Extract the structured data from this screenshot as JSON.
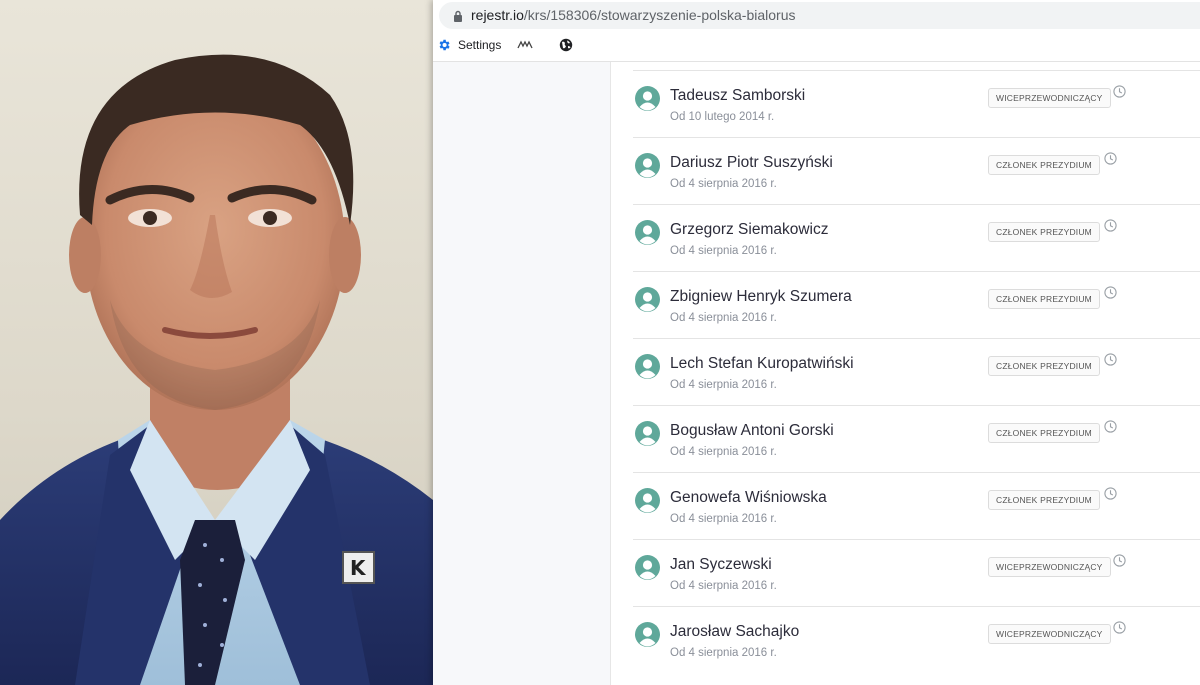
{
  "browser": {
    "url": {
      "host": "rejestr.io",
      "path": "/krs/158306/stowarzyszenie-polska-bialorus"
    },
    "bookmarks": [
      {
        "label": "Settings",
        "icon": "gear-icon"
      },
      {
        "label": "",
        "icon": "extension-icon"
      },
      {
        "label": "",
        "icon": "globe-icon"
      }
    ]
  },
  "people": [
    {
      "name": "Tadeusz Samborski",
      "date": "Od 10 lutego 2014 r.",
      "role": "WICEPRZEWODNICZĄCY"
    },
    {
      "name": "Dariusz Piotr Suszyński",
      "date": "Od 4 sierpnia 2016 r.",
      "role": "CZŁONEK PREZYDIUM"
    },
    {
      "name": "Grzegorz Siemakowicz",
      "date": "Od 4 sierpnia 2016 r.",
      "role": "CZŁONEK PREZYDIUM"
    },
    {
      "name": "Zbigniew Henryk Szumera",
      "date": "Od 4 sierpnia 2016 r.",
      "role": "CZŁONEK PREZYDIUM"
    },
    {
      "name": "Lech Stefan Kuropatwiński",
      "date": "Od 4 sierpnia 2016 r.",
      "role": "CZŁONEK PREZYDIUM"
    },
    {
      "name": "Bogusław Antoni Gorski",
      "date": "Od 4 sierpnia 2016 r.",
      "role": "CZŁONEK PREZYDIUM"
    },
    {
      "name": "Genowefa Wiśniowska",
      "date": "Od 4 sierpnia 2016 r.",
      "role": "CZŁONEK PREZYDIUM"
    },
    {
      "name": "Jan Syczewski",
      "date": "Od 4 sierpnia 2016 r.",
      "role": "WICEPRZEWODNICZĄCY"
    },
    {
      "name": "Jarosław Sachajko",
      "date": "Od 4 sierpnia 2016 r.",
      "role": "WICEPRZEWODNICZĄCY"
    }
  ],
  "colors": {
    "avatar": "#5fa89a",
    "accent": "#1a73e8"
  }
}
